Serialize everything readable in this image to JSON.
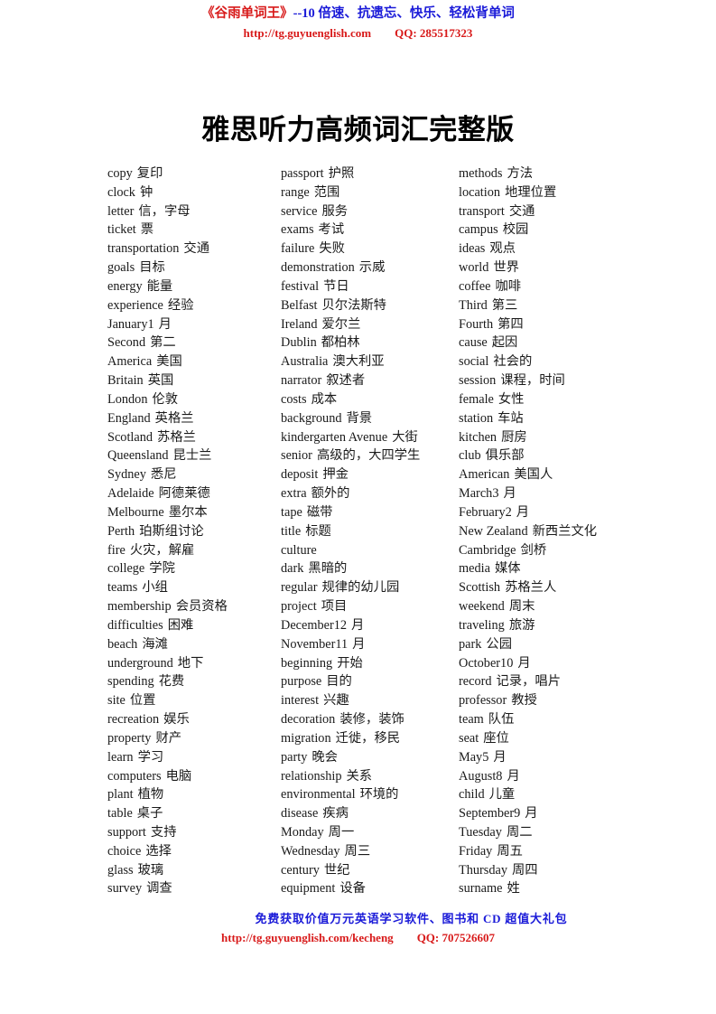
{
  "header": {
    "brand": "《谷雨单词王》",
    "tagline": "--10 倍速、抗遗忘、快乐、轻松背单词",
    "url": "http://tg.guyuenglish.com",
    "qq": "QQ: 285517323"
  },
  "title": "雅思听力高频词汇完整版",
  "footer": {
    "promo": "免费获取价值万元英语学习软件、图书和 CD 超值大礼包",
    "url": "http://tg.guyuenglish.com/kecheng",
    "qq": "QQ: 707526607"
  },
  "colors": {
    "brand_red": "#d81a1a",
    "accent_blue": "#1a1ad8",
    "text": "#1a1a1a"
  },
  "columns": [
    {
      "id": "column-1",
      "items": [
        {
          "en": "copy",
          "zh": "复印"
        },
        {
          "en": "clock",
          "zh": "钟"
        },
        {
          "en": "letter",
          "zh": "信，字母"
        },
        {
          "en": "ticket",
          "zh": "票"
        },
        {
          "en": "transportation",
          "zh": "交通"
        },
        {
          "en": "goals",
          "zh": "目标"
        },
        {
          "en": "energy",
          "zh": "能量"
        },
        {
          "en": "experience",
          "zh": "经验"
        },
        {
          "en": "January1",
          "zh": "月"
        },
        {
          "en": "Second",
          "zh": "第二"
        },
        {
          "en": "America",
          "zh": "美国"
        },
        {
          "en": "Britain",
          "zh": "英国"
        },
        {
          "en": "London",
          "zh": "伦敦"
        },
        {
          "en": "England",
          "zh": "英格兰"
        },
        {
          "en": "Scotland",
          "zh": "苏格兰"
        },
        {
          "en": "Queensland",
          "zh": "昆士兰"
        },
        {
          "en": "Sydney",
          "zh": "悉尼"
        },
        {
          "en": "Adelaide",
          "zh": "阿德莱德"
        },
        {
          "en": "Melbourne",
          "zh": "墨尔本"
        },
        {
          "en": "Perth",
          "zh": "珀斯组讨论"
        },
        {
          "en": "fire",
          "zh": "火灾，解雇"
        },
        {
          "en": "college",
          "zh": "学院"
        },
        {
          "en": "teams",
          "zh": "小组"
        },
        {
          "en": "membership",
          "zh": "会员资格"
        },
        {
          "en": "difficulties",
          "zh": "困难"
        },
        {
          "en": "beach",
          "zh": "海滩"
        },
        {
          "en": "underground",
          "zh": "地下"
        },
        {
          "en": "spending",
          "zh": "花费"
        },
        {
          "en": "site",
          "zh": "位置"
        },
        {
          "en": "recreation",
          "zh": "娱乐"
        },
        {
          "en": "property",
          "zh": "财产"
        },
        {
          "en": "learn",
          "zh": "学习"
        },
        {
          "en": "computers",
          "zh": "电脑"
        },
        {
          "en": "plant",
          "zh": "植物"
        },
        {
          "en": "table",
          "zh": "桌子"
        },
        {
          "en": "support",
          "zh": "支持"
        },
        {
          "en": "choice",
          "zh": "选择"
        },
        {
          "en": "glass",
          "zh": "玻璃"
        },
        {
          "en": "survey",
          "zh": "调查"
        }
      ]
    },
    {
      "id": "column-2",
      "items": [
        {
          "en": "passport",
          "zh": "护照"
        },
        {
          "en": "range",
          "zh": "范围"
        },
        {
          "en": "service",
          "zh": "服务"
        },
        {
          "en": "exams",
          "zh": "考试"
        },
        {
          "en": "failure",
          "zh": "失败"
        },
        {
          "en": "demonstration",
          "zh": "示威"
        },
        {
          "en": "festival",
          "zh": "节日"
        },
        {
          "en": "Belfast",
          "zh": "贝尔法斯特"
        },
        {
          "en": "Ireland",
          "zh": "爱尔兰"
        },
        {
          "en": "Dublin",
          "zh": "都柏林"
        },
        {
          "en": "Australia",
          "zh": "澳大利亚"
        },
        {
          "en": "narrator",
          "zh": "叙述者"
        },
        {
          "en": "costs",
          "zh": "成本"
        },
        {
          "en": "background",
          "zh": "背景"
        },
        {
          "en": "kindergarten Avenue",
          "zh": "大街"
        },
        {
          "en": "senior",
          "zh": "高级的，大四学生"
        },
        {
          "en": "deposit",
          "zh": "押金"
        },
        {
          "en": "extra",
          "zh": "额外的"
        },
        {
          "en": "tape",
          "zh": "磁带"
        },
        {
          "en": "title",
          "zh": "标题"
        },
        {
          "en": "culture",
          "zh": ""
        },
        {
          "en": "dark",
          "zh": "黑暗的"
        },
        {
          "en": "regular",
          "zh": "规律的幼儿园"
        },
        {
          "en": "project",
          "zh": "项目"
        },
        {
          "en": "December12",
          "zh": "月"
        },
        {
          "en": "November11",
          "zh": "月"
        },
        {
          "en": "beginning",
          "zh": "开始"
        },
        {
          "en": "purpose",
          "zh": "目的"
        },
        {
          "en": "interest",
          "zh": "兴趣"
        },
        {
          "en": "decoration",
          "zh": "装修，装饰"
        },
        {
          "en": "migration",
          "zh": "迁徙，移民"
        },
        {
          "en": "party",
          "zh": "晚会"
        },
        {
          "en": "relationship",
          "zh": "关系"
        },
        {
          "en": "environmental",
          "zh": "环境的"
        },
        {
          "en": "disease",
          "zh": "疾病"
        },
        {
          "en": "Monday",
          "zh": "周一"
        },
        {
          "en": "Wednesday",
          "zh": "周三"
        },
        {
          "en": "century",
          "zh": "世纪"
        },
        {
          "en": "equipment",
          "zh": "设备"
        }
      ]
    },
    {
      "id": "column-3",
      "items": [
        {
          "en": "methods",
          "zh": "方法"
        },
        {
          "en": "location",
          "zh": "地理位置"
        },
        {
          "en": "transport",
          "zh": "交通"
        },
        {
          "en": "campus",
          "zh": "校园"
        },
        {
          "en": "ideas",
          "zh": "观点"
        },
        {
          "en": "world",
          "zh": "世界"
        },
        {
          "en": "coffee",
          "zh": "咖啡"
        },
        {
          "en": "Third",
          "zh": "第三"
        },
        {
          "en": "Fourth",
          "zh": "第四"
        },
        {
          "en": "cause",
          "zh": "起因"
        },
        {
          "en": "social",
          "zh": "社会的"
        },
        {
          "en": "session",
          "zh": "课程，时间"
        },
        {
          "en": "female",
          "zh": "女性"
        },
        {
          "en": "station",
          "zh": "车站"
        },
        {
          "en": "kitchen",
          "zh": "厨房"
        },
        {
          "en": "club",
          "zh": "俱乐部"
        },
        {
          "en": "American",
          "zh": "美国人"
        },
        {
          "en": "March3",
          "zh": "月"
        },
        {
          "en": "February2",
          "zh": "月"
        },
        {
          "en": "New Zealand",
          "zh": "新西兰文化"
        },
        {
          "en": "Cambridge",
          "zh": "剑桥"
        },
        {
          "en": "media",
          "zh": "媒体"
        },
        {
          "en": "Scottish",
          "zh": "苏格兰人"
        },
        {
          "en": "weekend",
          "zh": "周末"
        },
        {
          "en": "traveling",
          "zh": "旅游"
        },
        {
          "en": "park",
          "zh": "公园"
        },
        {
          "en": "October10",
          "zh": "月"
        },
        {
          "en": "record",
          "zh": "记录，唱片"
        },
        {
          "en": "professor",
          "zh": "教授"
        },
        {
          "en": "team",
          "zh": "队伍"
        },
        {
          "en": "seat",
          "zh": "座位"
        },
        {
          "en": "May5",
          "zh": "月"
        },
        {
          "en": "August8",
          "zh": "月"
        },
        {
          "en": "child",
          "zh": "儿童"
        },
        {
          "en": "September9",
          "zh": "月"
        },
        {
          "en": "Tuesday",
          "zh": "周二"
        },
        {
          "en": "Friday",
          "zh": "周五"
        },
        {
          "en": "Thursday",
          "zh": "周四"
        },
        {
          "en": "surname",
          "zh": "姓"
        }
      ]
    }
  ]
}
